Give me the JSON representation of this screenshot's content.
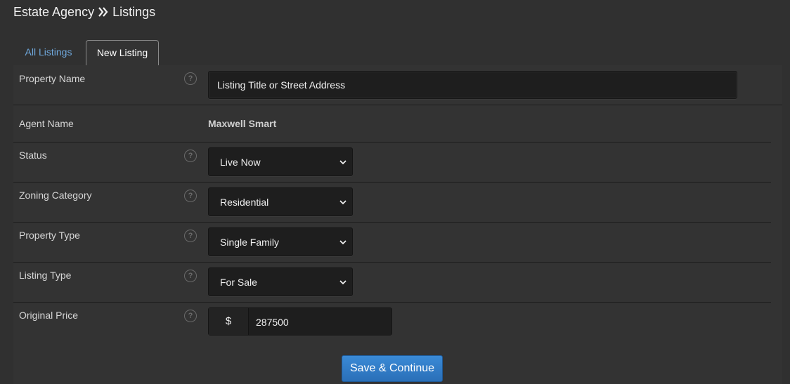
{
  "breadcrumb": {
    "root": "Estate Agency",
    "separator_icon": "double-chevron-right",
    "current": "Listings"
  },
  "tabs": [
    {
      "label": "All Listings",
      "active": false
    },
    {
      "label": "New Listing",
      "active": true
    }
  ],
  "form": {
    "property_name": {
      "label": "Property Name",
      "placeholder": "Listing Title or Street Address",
      "value": ""
    },
    "agent_name": {
      "label": "Agent Name",
      "value": "Maxwell Smart"
    },
    "status": {
      "label": "Status",
      "selected": "Live Now"
    },
    "zoning_category": {
      "label": "Zoning Category",
      "selected": "Residential"
    },
    "property_type": {
      "label": "Property Type",
      "selected": "Single Family"
    },
    "listing_type": {
      "label": "Listing Type",
      "selected": "For Sale"
    },
    "original_price": {
      "label": "Original Price",
      "currency_symbol": "$",
      "value": "287500"
    },
    "help_icon": "question-circle",
    "help_glyph": "?"
  },
  "actions": {
    "save_label": "Save & Continue"
  },
  "colors": {
    "background": "#303030",
    "tab_link": "#6fa8dc",
    "primary_button": "#2f7cc7"
  }
}
